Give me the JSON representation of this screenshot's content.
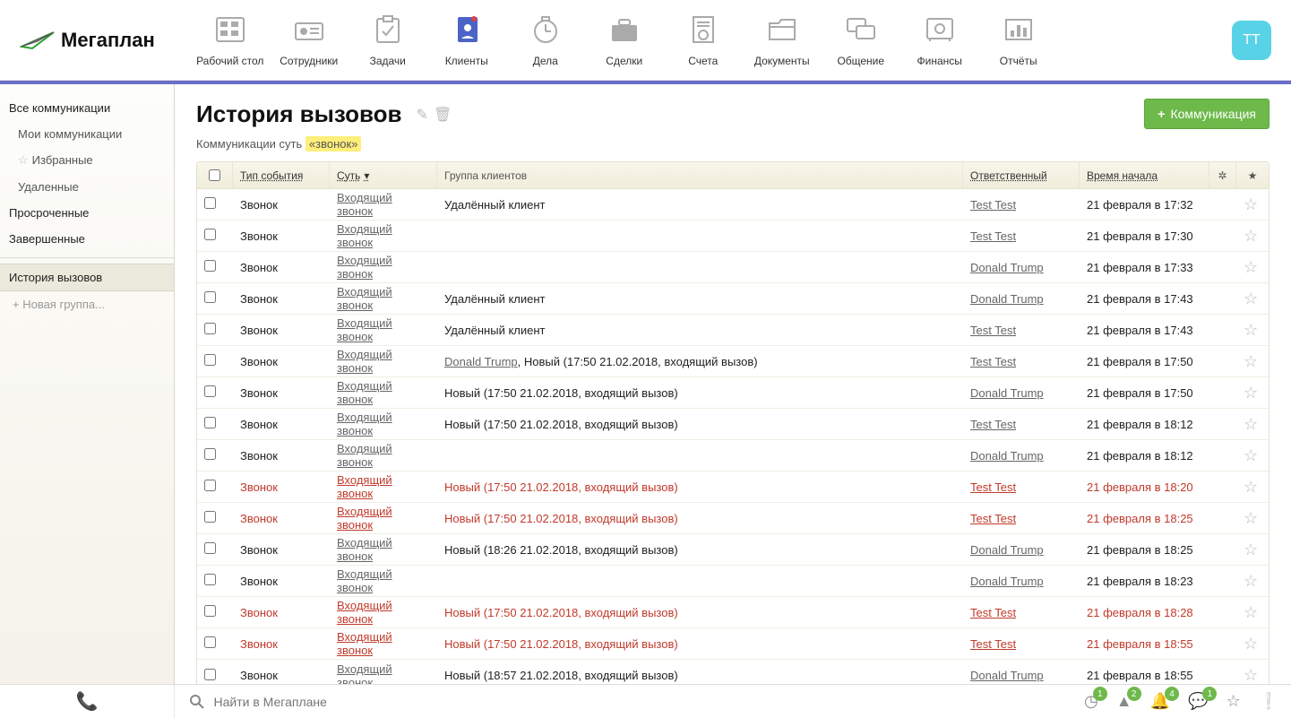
{
  "brand": "Мегаплан",
  "avatar": "ТТ",
  "nav": {
    "desktop": "Рабочий стол",
    "employees": "Сотрудники",
    "tasks": "Задачи",
    "clients": "Клиенты",
    "affairs": "Дела",
    "deals": "Сделки",
    "accounts": "Счета",
    "documents": "Документы",
    "chat": "Общение",
    "finance": "Финансы",
    "reports": "Отчёты"
  },
  "sidebar": {
    "all": "Все коммуникации",
    "my": "Мои коммуникации",
    "fav": "Избранные",
    "deleted": "Удаленные",
    "overdue": "Просроченные",
    "done": "Завершенные",
    "history": "История вызовов",
    "add_group": "+  Новая группа..."
  },
  "page": {
    "title": "История вызовов",
    "subtext_prefix": "Коммуникации суть ",
    "subtext_tag": "«звонок»",
    "create_btn": "Коммуникация"
  },
  "columns": {
    "type": "Тип события",
    "sut": "Суть",
    "group": "Группа клиентов",
    "resp": "Ответственный",
    "time": "Время начала"
  },
  "rows": [
    {
      "type": "Звонок",
      "sut": "Входящий звонок",
      "group": "Удалённый клиент",
      "resp": "Test Test",
      "time": "21 февраля в 17:32",
      "danger": false
    },
    {
      "type": "Звонок",
      "sut": "Входящий звонок",
      "group": "",
      "resp": "Test Test",
      "time": "21 февраля в 17:30",
      "danger": false
    },
    {
      "type": "Звонок",
      "sut": "Входящий звонок",
      "group": "",
      "resp": "Donald Trump",
      "time": "21 февраля в 17:33",
      "danger": false
    },
    {
      "type": "Звонок",
      "sut": "Входящий звонок",
      "group": "Удалённый клиент",
      "resp": "Donald Trump",
      "time": "21 февраля в 17:43",
      "danger": false
    },
    {
      "type": "Звонок",
      "sut": "Входящий звонок",
      "group": "Удалённый клиент",
      "resp": "Test Test",
      "time": "21 февраля в 17:43",
      "danger": false
    },
    {
      "type": "Звонок",
      "sut": "Входящий звонок",
      "group": "Donald Trump, Новый (17:50 21.02.2018, входящий вызов)",
      "group_link": "Donald Trump",
      "resp": "Test Test",
      "time": "21 февраля в 17:50",
      "danger": false
    },
    {
      "type": "Звонок",
      "sut": "Входящий звонок",
      "group": "Новый (17:50 21.02.2018, входящий вызов)",
      "resp": "Donald Trump",
      "time": "21 февраля в 17:50",
      "danger": false
    },
    {
      "type": "Звонок",
      "sut": "Входящий звонок",
      "group": "Новый (17:50 21.02.2018, входящий вызов)",
      "resp": "Test Test",
      "time": "21 февраля в 18:12",
      "danger": false
    },
    {
      "type": "Звонок",
      "sut": "Входящий звонок",
      "group": "",
      "resp": "Donald Trump",
      "time": "21 февраля в 18:12",
      "danger": false
    },
    {
      "type": "Звонок",
      "sut": "Входящий звонок",
      "group": "Новый (17:50 21.02.2018, входящий вызов)",
      "resp": "Test Test",
      "time": "21 февраля в 18:20",
      "danger": true
    },
    {
      "type": "Звонок",
      "sut": "Входящий звонок",
      "group": "Новый (17:50 21.02.2018, входящий вызов)",
      "resp": "Test Test",
      "time": "21 февраля в 18:25",
      "danger": true
    },
    {
      "type": "Звонок",
      "sut": "Входящий звонок",
      "group": "Новый (18:26 21.02.2018, входящий вызов)",
      "resp": "Donald Trump",
      "time": "21 февраля в 18:25",
      "danger": false
    },
    {
      "type": "Звонок",
      "sut": "Входящий звонок",
      "group": "",
      "resp": "Donald Trump",
      "time": "21 февраля в 18:23",
      "danger": false
    },
    {
      "type": "Звонок",
      "sut": "Входящий звонок",
      "group": "Новый (17:50 21.02.2018, входящий вызов)",
      "resp": "Test Test",
      "time": "21 февраля в 18:28",
      "danger": true
    },
    {
      "type": "Звонок",
      "sut": "Входящий звонок",
      "group": "Новый (17:50 21.02.2018, входящий вызов)",
      "resp": "Test Test",
      "time": "21 февраля в 18:55",
      "danger": true
    },
    {
      "type": "Звонок",
      "sut": "Входящий звонок",
      "group": "Новый (18:57 21.02.2018, входящий вызов)",
      "resp": "Donald Trump",
      "time": "21 февраля в 18:55",
      "danger": false
    }
  ],
  "footer": {
    "search_placeholder": "Найти в Мегаплане",
    "badges": {
      "clock": "1",
      "fire": "2",
      "bell": "4",
      "chat": "1"
    }
  }
}
